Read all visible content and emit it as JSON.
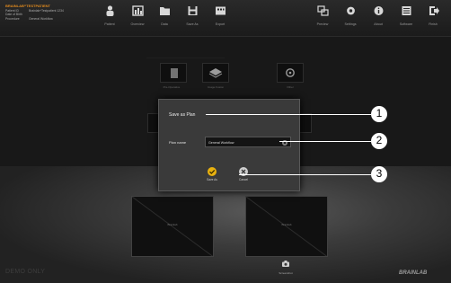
{
  "patient": {
    "name": "BRAINLAB^TESTPATIENT",
    "rows": [
      [
        "Patient ID",
        "Brainlab^Testpatient 1234"
      ],
      [
        "Date of Birth",
        ""
      ],
      [
        "Procedure",
        "General Workflow"
      ]
    ]
  },
  "toolbar": {
    "items": [
      {
        "label": "Patient",
        "icon": "patient-icon"
      },
      {
        "label": "Overview",
        "icon": "overview-icon"
      },
      {
        "label": "Data",
        "icon": "folder-icon"
      },
      {
        "label": "Save As",
        "icon": "save-icon"
      },
      {
        "label": "Export",
        "icon": "export-icon"
      },
      {
        "label": "Preview",
        "icon": "preview-icon"
      },
      {
        "label": "Settings",
        "icon": "gear-icon"
      },
      {
        "label": "About",
        "icon": "info-icon"
      },
      {
        "label": "Software",
        "icon": "software-icon"
      },
      {
        "label": "Finish",
        "icon": "finish-icon"
      }
    ]
  },
  "workspace": {
    "group_left": "",
    "group_right": "",
    "thumbs": [
      {
        "label": "Pre-Operative"
      },
      {
        "label": "Image Fusion"
      },
      {
        "label": "Other"
      }
    ],
    "view_left_label": "Brainlab",
    "view_right_label": "Brainlab",
    "screenshot_label": "Screenshot",
    "watermark": "DEMO ONLY",
    "brand": "BRAINLAB"
  },
  "dialog": {
    "title": "Save as Plan",
    "field_label": "Plan name",
    "field_value": "General Workflow",
    "save_label": "Save As",
    "cancel_label": "Cancel"
  },
  "callouts": [
    "1",
    "2",
    "3"
  ],
  "colors": {
    "accent_orange": "#e08a1e",
    "save_yellow": "#e8b10f",
    "cancel_gray": "#cfcfcf",
    "group_green": "#3e8a55",
    "group_red": "#a8323a"
  }
}
